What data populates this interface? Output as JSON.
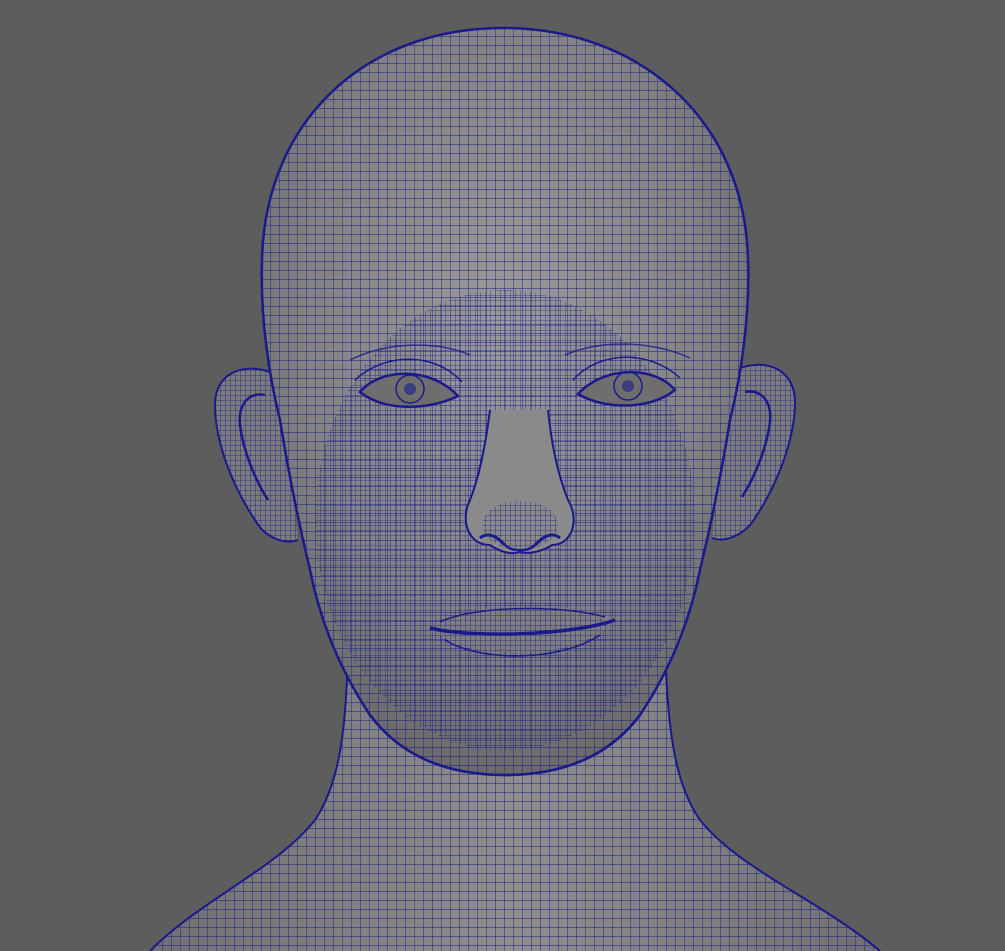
{
  "viewport": {
    "background_color": "#5d5d5d",
    "shaded_surface_color": "#8a8a8a",
    "wireframe_color": "#1a1a8c",
    "display_mode": "wireframe-on-shaded",
    "subject": "head-and-neck-mesh"
  }
}
